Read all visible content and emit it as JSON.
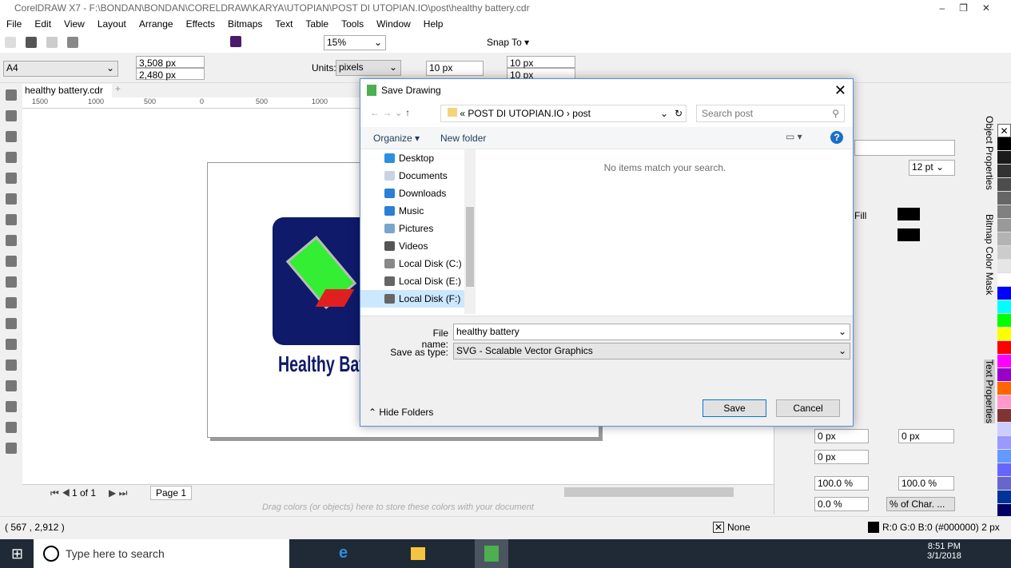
{
  "app": {
    "title": "CorelDRAW X7 - F:\\BONDAN\\BONDAN\\CORELDRAW\\KARYA\\UTOPIAN\\POST DI UTOPIAN.IO\\post\\healthy battery.cdr"
  },
  "menu": [
    "File",
    "Edit",
    "View",
    "Layout",
    "Arrange",
    "Effects",
    "Bitmaps",
    "Text",
    "Table",
    "Tools",
    "Window",
    "Help"
  ],
  "toolbar": {
    "zoom": "15%",
    "snap_to": "Snap To"
  },
  "propbar": {
    "page_size": "A4",
    "width": "3,508 px",
    "height": "2,480 px",
    "units_label": "Units:",
    "units": "pixels",
    "nudge": "10 px",
    "dup_x": "10 px",
    "dup_y": "10 px"
  },
  "document_tab": "healthy battery.cdr",
  "ruler_ticks": [
    "1500",
    "1000",
    "500",
    "0",
    "500",
    "1000"
  ],
  "artwork_text": "Healthy Bat",
  "page_nav": {
    "count": "1 of 1",
    "page_tab": "Page 1"
  },
  "color_tray_hint": "Drag colors (or objects) here to store these colors with your document",
  "status": {
    "coords": "( 567 , 2,912 )",
    "fill": "None",
    "outline": "R:0 G:0 B:0 (#000000)  2 px"
  },
  "dock": {
    "font_size": "12 pt",
    "fill_label": "Fill",
    "indent_left": "0 px",
    "indent_first": "0 px",
    "indent_right": "0 px",
    "line_spacing": "100.0 %",
    "char_spacing": "100.0 %",
    "before_para": "0.0 %",
    "spacing_unit": "% of Char. ...",
    "tabs": [
      "Object Properties",
      "Bitmap Color Mask",
      "Text Properties"
    ]
  },
  "palette": [
    "#000000",
    "#1a1a1a",
    "#333333",
    "#4d4d4d",
    "#666666",
    "#808080",
    "#999999",
    "#b3b3b3",
    "#cccccc",
    "#e6e6e6",
    "#ffffff",
    "#0000ff",
    "#00ffff",
    "#00ff00",
    "#ffff00",
    "#ff0000",
    "#ff00ff",
    "#9900cc",
    "#ff6600",
    "#ff99cc",
    "#803333",
    "#ccccff",
    "#9999ff",
    "#6699ff",
    "#6666ff",
    "#6666cc",
    "#003399",
    "#000066"
  ],
  "dialog": {
    "title": "Save Drawing",
    "breadcrumb": [
      "POST DI UTOPIAN.IO",
      "post"
    ],
    "search_placeholder": "Search post",
    "organize": "Organize ▾",
    "new_folder": "New folder",
    "empty_message": "No items match your search.",
    "nav": [
      {
        "label": "Desktop",
        "color": "#2b8fe0"
      },
      {
        "label": "Documents",
        "color": "#c8d4e0"
      },
      {
        "label": "Downloads",
        "color": "#2b7fd4"
      },
      {
        "label": "Music",
        "color": "#2b7fd4"
      },
      {
        "label": "Pictures",
        "color": "#7aa6cc"
      },
      {
        "label": "Videos",
        "color": "#555555"
      },
      {
        "label": "Local Disk (C:)",
        "color": "#888888"
      },
      {
        "label": "Local Disk (E:)",
        "color": "#666666"
      },
      {
        "label": "Local Disk (F:)",
        "color": "#666666"
      }
    ],
    "file_name_label": "File name:",
    "file_name": "healthy battery",
    "save_type_label": "Save as type:",
    "save_type": "SVG - Scalable Vector Graphics",
    "hide_folders": "Hide Folders",
    "save": "Save",
    "cancel": "Cancel"
  },
  "taskbar": {
    "search": "Type here to search",
    "time": "8:51 PM",
    "date": "3/1/2018"
  }
}
